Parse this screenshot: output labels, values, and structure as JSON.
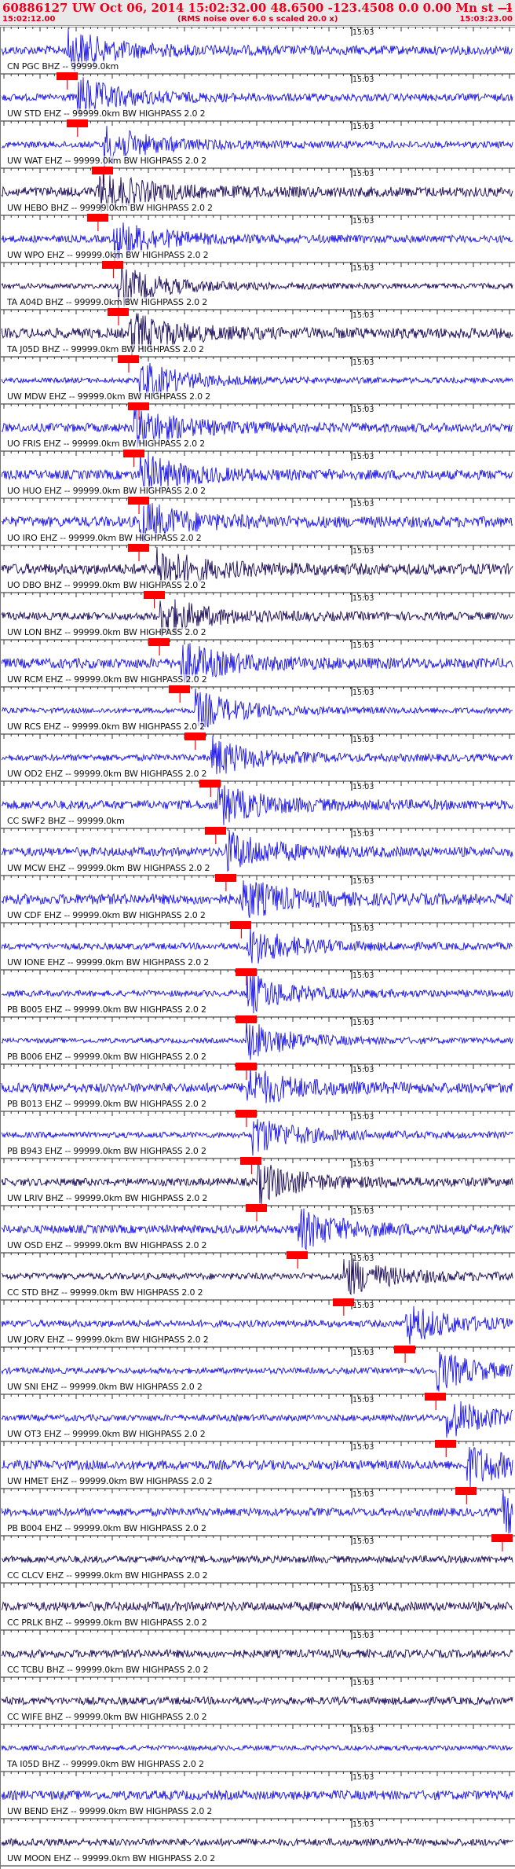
{
  "header": {
    "title": "60886127 UW Oct 06, 2014 15:02:32.00   48.6500 -123.4508  0.0 0.00 Mn st --- -- --",
    "suffix": "-1",
    "start_time": "15:02:12.00",
    "noise_note": "(RMS noise over 6.0 s scaled 20.0 x)",
    "end_time": "15:03:23.00"
  },
  "time_tick_label": "15:03",
  "colors": {
    "header_text": "#e8001c",
    "header_bg": "#e9e9e9",
    "trace_blue": "#1b14e8",
    "trace_navy": "#1a0a5a",
    "pick_marker": "#ff0000",
    "pick_line": "#ff0000"
  },
  "traces": [
    {
      "label": "CN PGC BHZ -- 99999.0km",
      "color": "blue",
      "pick": 0.13
    },
    {
      "label": "UW STD EHZ -- 99999.0km BW  HIGHPASS  2.0  2",
      "color": "blue",
      "pick": 0.15
    },
    {
      "label": "UW WAT EHZ -- 99999.0km BW  HIGHPASS  2.0  2",
      "color": "blue",
      "pick": 0.2
    },
    {
      "label": "UW HEBO BHZ -- 99999.0km BW  HIGHPASS  2.0  2",
      "color": "navy",
      "pick": 0.19
    },
    {
      "label": "UW WPO EHZ -- 99999.0km BW  HIGHPASS  2.0  2",
      "color": "blue",
      "pick": 0.22
    },
    {
      "label": "TA A04D BHZ -- 99999.0km BW  HIGHPASS  2.0  2",
      "color": "navy",
      "pick": 0.23
    },
    {
      "label": "TA J05D BHZ -- 99999.0km BW  HIGHPASS  2.0  2",
      "color": "navy",
      "pick": 0.25
    },
    {
      "label": "UW MDW EHZ -- 99999.0km BW  HIGHPASS  2.0  2",
      "color": "blue",
      "pick": 0.27
    },
    {
      "label": "UO FRIS EHZ -- 99999.0km BW  HIGHPASS  2.0  2",
      "color": "blue",
      "pick": 0.26
    },
    {
      "label": "UO HUO EHZ -- 99999.0km BW  HIGHPASS  2.0  2",
      "color": "blue",
      "pick": 0.27
    },
    {
      "label": "UO IRO EHZ -- 99999.0km BW  HIGHPASS  2.0  2",
      "color": "blue",
      "pick": 0.27
    },
    {
      "label": "UO DBO BHZ -- 99999.0km BW  HIGHPASS  2.0  2",
      "color": "navy",
      "pick": 0.3
    },
    {
      "label": "UW LON BHZ -- 99999.0km BW  HIGHPASS  2.0  2",
      "color": "navy",
      "pick": 0.31
    },
    {
      "label": "UW RCM EHZ -- 99999.0km BW  HIGHPASS  2.0  2",
      "color": "blue",
      "pick": 0.35
    },
    {
      "label": "UW RCS EHZ -- 99999.0km BW  HIGHPASS  2.0  2",
      "color": "blue",
      "pick": 0.38
    },
    {
      "label": "UW OD2 EHZ -- 99999.0km BW  HIGHPASS  2.0  2",
      "color": "blue",
      "pick": 0.41
    },
    {
      "label": "CC SWF2 BHZ -- 99999.0km",
      "color": "blue",
      "pick": 0.42
    },
    {
      "label": "UW MCW EHZ -- 99999.0km BW  HIGHPASS  2.0  2",
      "color": "blue",
      "pick": 0.44
    },
    {
      "label": "UW CDF EHZ -- 99999.0km BW  HIGHPASS  2.0  2",
      "color": "blue",
      "pick": 0.47
    },
    {
      "label": "UW IONE EHZ -- 99999.0km BW  HIGHPASS  2.0  2",
      "color": "blue",
      "pick": 0.48
    },
    {
      "label": "PB B005 EHZ -- 99999.0km BW  HIGHPASS  2.0  2",
      "color": "blue",
      "pick": 0.48
    },
    {
      "label": "PB B006 EHZ -- 99999.0km BW  HIGHPASS  2.0  2",
      "color": "blue",
      "pick": 0.48
    },
    {
      "label": "PB B013 EHZ -- 99999.0km BW  HIGHPASS  2.0  2",
      "color": "blue",
      "pick": 0.48
    },
    {
      "label": "PB B943 EHZ -- 99999.0km BW  HIGHPASS  2.0  2",
      "color": "blue",
      "pick": 0.49
    },
    {
      "label": "UW LRIV BHZ -- 99999.0km BW  HIGHPASS  2.0  2",
      "color": "navy",
      "pick": 0.5
    },
    {
      "label": "UW OSD EHZ -- 99999.0km BW  HIGHPASS  2.0  2",
      "color": "blue",
      "pick": 0.58
    },
    {
      "label": "CC STD BHZ -- 99999.0km BW  HIGHPASS  2.0  2",
      "color": "navy",
      "pick": 0.67
    },
    {
      "label": "UW JORV EHZ -- 99999.0km BW  HIGHPASS  2.0  2",
      "color": "blue",
      "pick": 0.79
    },
    {
      "label": "UW SNI EHZ -- 99999.0km BW  HIGHPASS  2.0  2",
      "color": "blue",
      "pick": 0.85
    },
    {
      "label": "UW OT3 EHZ -- 99999.0km BW  HIGHPASS  2.0  2",
      "color": "blue",
      "pick": 0.87
    },
    {
      "label": "UW HMET EHZ -- 99999.0km BW  HIGHPASS  2.0  2",
      "color": "blue",
      "pick": 0.91
    },
    {
      "label": "PB B004 EHZ -- 99999.0km BW  HIGHPASS  2.0  2",
      "color": "blue",
      "pick": 0.98
    },
    {
      "label": "CC CLCV EHZ -- 99999.0km BW  HIGHPASS  2.0  2",
      "color": "navy",
      "pick": null
    },
    {
      "label": "CC PRLK BHZ -- 99999.0km BW  HIGHPASS  2.0  2",
      "color": "navy",
      "pick": null
    },
    {
      "label": "CC TCBU BHZ -- 99999.0km BW  HIGHPASS  2.0  2",
      "color": "navy",
      "pick": null
    },
    {
      "label": "CC WIFE BHZ -- 99999.0km BW  HIGHPASS  2.0  2",
      "color": "navy",
      "pick": null
    },
    {
      "label": "TA I05D BHZ -- 99999.0km BW  HIGHPASS  2.0  2",
      "color": "blue",
      "pick": null
    },
    {
      "label": "UW BEND EHZ -- 99999.0km BW  HIGHPASS  2.0  2",
      "color": "blue",
      "pick": null
    },
    {
      "label": "UW MOON EHZ -- 99999.0km BW  HIGHPASS  2.0  2",
      "color": "navy",
      "pick": null
    }
  ]
}
